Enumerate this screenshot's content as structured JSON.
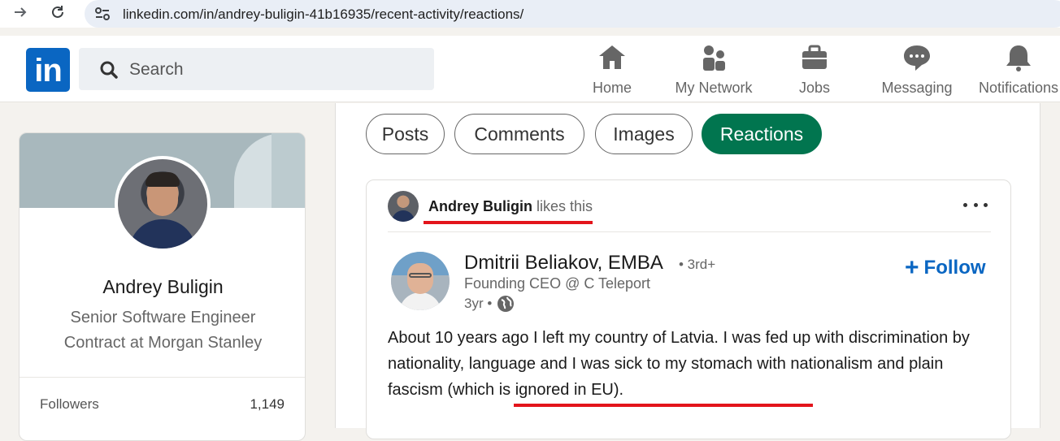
{
  "browser": {
    "url": "linkedin.com/in/andrey-buligin-41b16935/recent-activity/reactions/"
  },
  "header": {
    "logo_text": "in",
    "search_placeholder": "Search",
    "nav": [
      {
        "label": "Home",
        "icon": "home-icon"
      },
      {
        "label": "My Network",
        "icon": "network-icon"
      },
      {
        "label": "Jobs",
        "icon": "briefcase-icon"
      },
      {
        "label": "Messaging",
        "icon": "chat-icon"
      },
      {
        "label": "Notifications",
        "icon": "bell-icon"
      }
    ]
  },
  "profile": {
    "name": "Andrey Buligin",
    "headline": "Senior Software Engineer Contract at Morgan Stanley",
    "followers_label": "Followers",
    "followers_count": "1,149"
  },
  "tabs": [
    {
      "label": "Posts",
      "active": false
    },
    {
      "label": "Comments",
      "active": false
    },
    {
      "label": "Images",
      "active": false
    },
    {
      "label": "Reactions",
      "active": true
    }
  ],
  "post": {
    "reactor_name": "Andrey Buligin",
    "reactor_action": " likes this",
    "author_name": "Dmitrii Beliakov, EMBA",
    "author_degree": "• 3rd+",
    "author_title": "Founding CEO @ C Teleport",
    "post_age": "3yr •",
    "follow_label": "Follow",
    "text": "About 10 years ago I left my country of Latvia. I was fed up with discrimination by nationality, language and I was sick to my stomach with nationalism and plain fascism (which is ignored in EU)."
  },
  "colors": {
    "linkedin_blue": "#0a66c2",
    "active_tab_green": "#01754f",
    "annotation_red": "#e3141b"
  }
}
